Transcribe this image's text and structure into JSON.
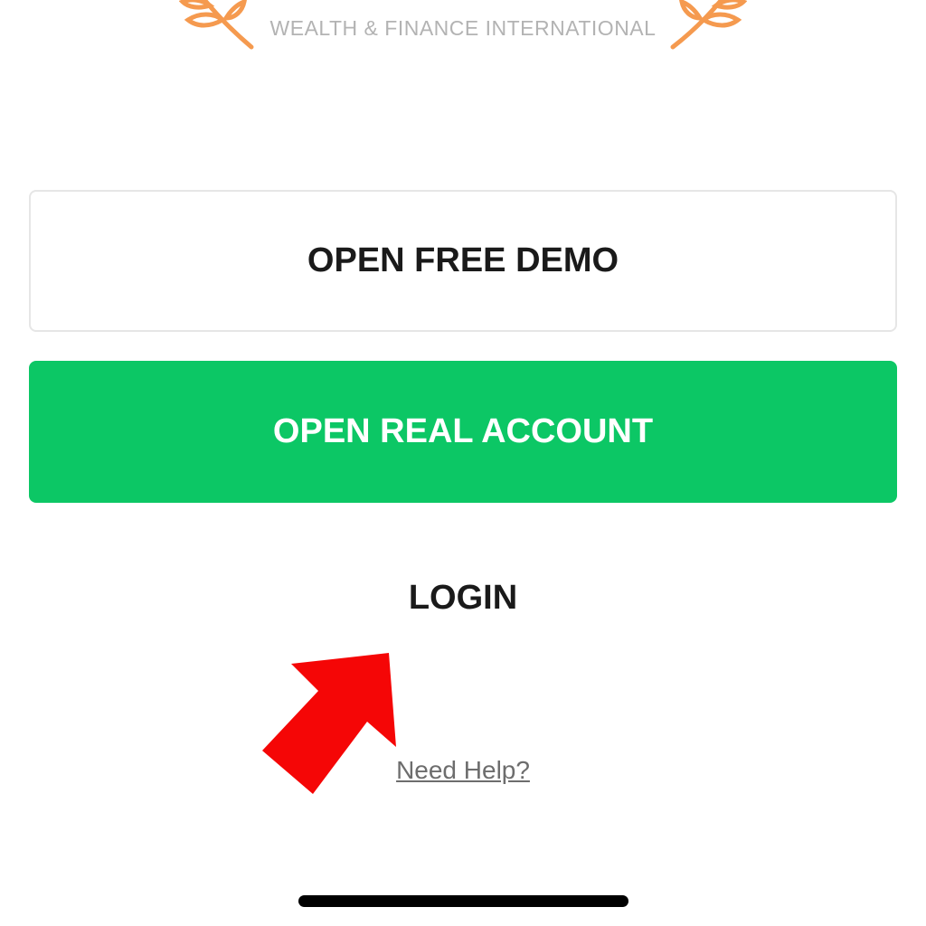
{
  "header": {
    "award_text": "WEALTH & FINANCE INTERNATIONAL",
    "laurel_color": "#f59a4f"
  },
  "actions": {
    "demo_label": "OPEN FREE DEMO",
    "real_label": "OPEN REAL ACCOUNT",
    "login_label": "LOGIN",
    "help_label": "Need Help?"
  },
  "colors": {
    "accent_green": "#0cc765",
    "annotation_arrow": "#f50606",
    "text_dark": "#1a1a1a",
    "text_muted": "#6d6d6d"
  },
  "annotation": {
    "icon": "red-arrow-icon"
  }
}
